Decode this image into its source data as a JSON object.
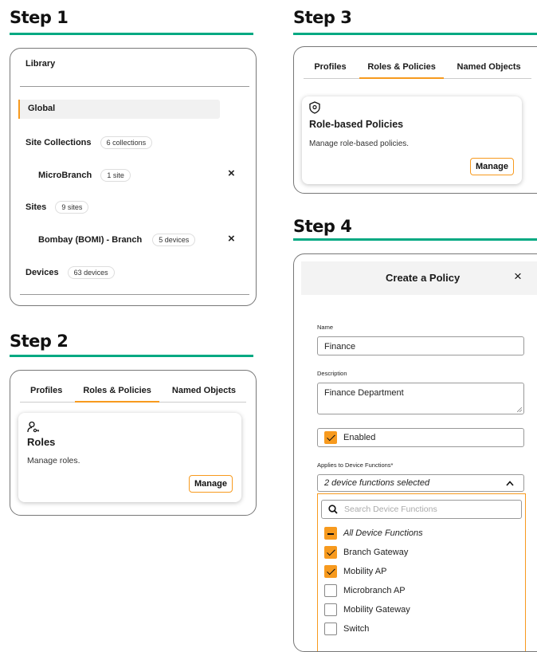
{
  "steps": {
    "s1": "Step 1",
    "s2": "Step 2",
    "s3": "Step 3",
    "s4": "Step 4"
  },
  "library": {
    "title": "Library",
    "global": "Global",
    "site_collections": {
      "label": "Site Collections",
      "badge": "6 collections"
    },
    "microbranch": {
      "label": "MicroBranch",
      "badge": "1 site"
    },
    "sites": {
      "label": "Sites",
      "badge": "9 sites"
    },
    "bombay": {
      "label": "Bombay (BOMI) - Branch",
      "badge": "5 devices"
    },
    "devices": {
      "label": "Devices",
      "badge": "63 devices"
    },
    "close_glyph": "×"
  },
  "tabs": {
    "profiles": "Profiles",
    "roles_policies": "Roles & Policies",
    "named_objects": "Named Objects"
  },
  "roles_card": {
    "title": "Roles",
    "desc": "Manage roles.",
    "button": "Manage",
    "icon": "user-key-icon"
  },
  "policies_card": {
    "title": "Role-based Policies",
    "desc": "Manage role-based policies.",
    "button": "Manage",
    "icon": "shield-icon"
  },
  "create_policy": {
    "title": "Create a Policy",
    "close": "×",
    "name_label": "Name",
    "name_value": "Finance",
    "desc_label": "Description",
    "desc_value": "Finance Department",
    "enabled_label": "Enabled",
    "applies_label": "Applies to Device Functions*",
    "applies_value": "2 device functions selected",
    "search_placeholder": "Search Device Functions",
    "options": [
      {
        "label": "All Device Functions",
        "state": "indeterminate"
      },
      {
        "label": "Branch Gateway",
        "state": "checked"
      },
      {
        "label": "Mobility AP",
        "state": "checked"
      },
      {
        "label": "Microbranch AP",
        "state": "unchecked"
      },
      {
        "label": "Mobility Gateway",
        "state": "unchecked"
      },
      {
        "label": "Switch",
        "state": "unchecked"
      }
    ]
  },
  "colors": {
    "accent_green": "#01a982",
    "accent_orange": "#f79a1e"
  }
}
